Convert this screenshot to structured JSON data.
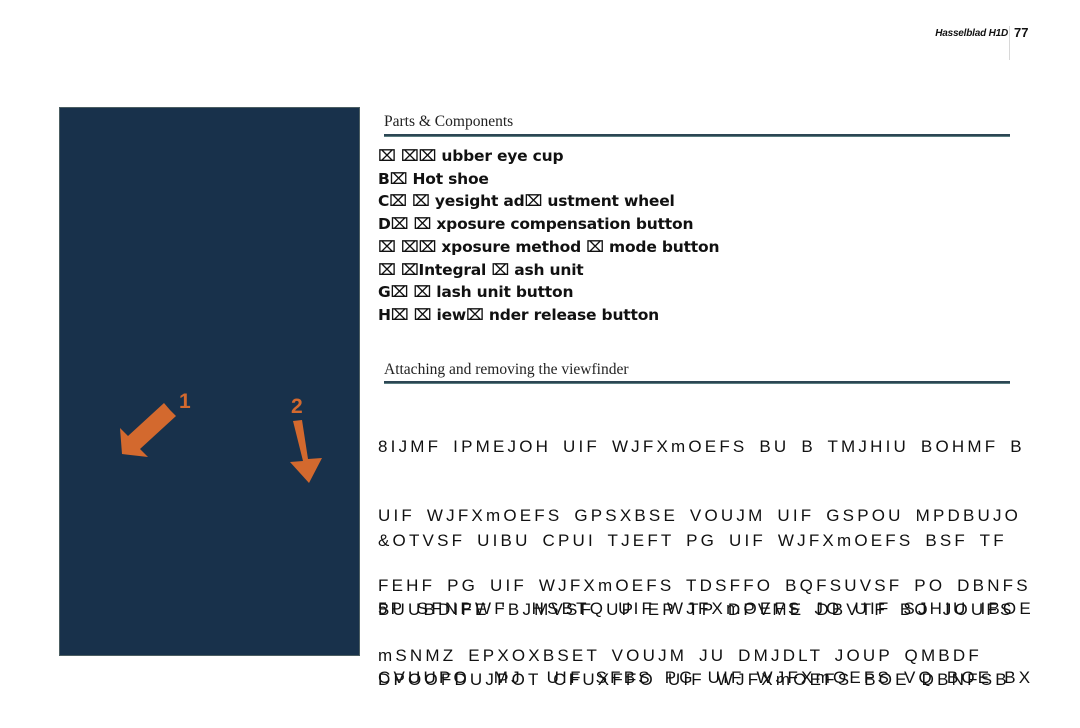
{
  "running_head": {
    "brand": "Hasselblad H1D",
    "page_number": "77"
  },
  "figure": {
    "background_color": "#18314b",
    "arrow_color": "#d3692e",
    "callouts": [
      {
        "label": "1",
        "icon": "arrow-down-left-icon"
      },
      {
        "label": "2",
        "icon": "arrow-down-icon"
      }
    ]
  },
  "parts_section": {
    "heading": "Parts & Components",
    "items": [
      "⌧ ⌧⌧ ubber eye cup",
      "B⌧ Hot shoe",
      "C⌧ ⌧ yesight ad⌧ ustment wheel",
      "D⌧ ⌧ xposure compensation button",
      "⌧ ⌧⌧ xposure method ⌧ mode button",
      "⌧ ⌧Integral ⌧ ash unit",
      "G⌧ ⌧ lash unit button",
      "H⌧ ⌧ iew⌧ nder release button"
    ]
  },
  "viewfinder_section": {
    "heading": "Attaching and removing the viewfinder",
    "paragraphs": [
      {
        "lines": [
          "8IJMF IPMEJOH UIF WJFXmOEFS BU B TMJHIU BOHMF B",
          "UIF WJFXmOEFS GPSXBSE VOUJM UIF GSPOU MPDBUJO",
          "FEHF PG UIF WJFXmOEFS TDSFFO BQFSUVSF PO DBNFS",
          "mSNMZ EPXOXBSET VOUJM JU DMJDLT JOUP QMBDF"
        ]
      },
      {
        "lines": [
          "&OTVSF UIBU CPUI TJEFT PG UIF WJFXmOEFS BSF TF",
          "BUUBDIFE 'BJMVSF UP EP TP DPVME DBVTF BO JOUFS",
          "DPOOFDUJPOT CFUXFFO UIF WJFXmOEFS BOE DBNFSB"
        ]
      },
      {
        "lines": [
          "5P SFNPWF  HSBTQ UIF WJFXmOEFS JO UIF SJHIU IBOE",
          "CVUUPO  MJ  UIF SFBS PG UIF WJFXmOEFS VQ BOE BX"
        ]
      }
    ]
  }
}
